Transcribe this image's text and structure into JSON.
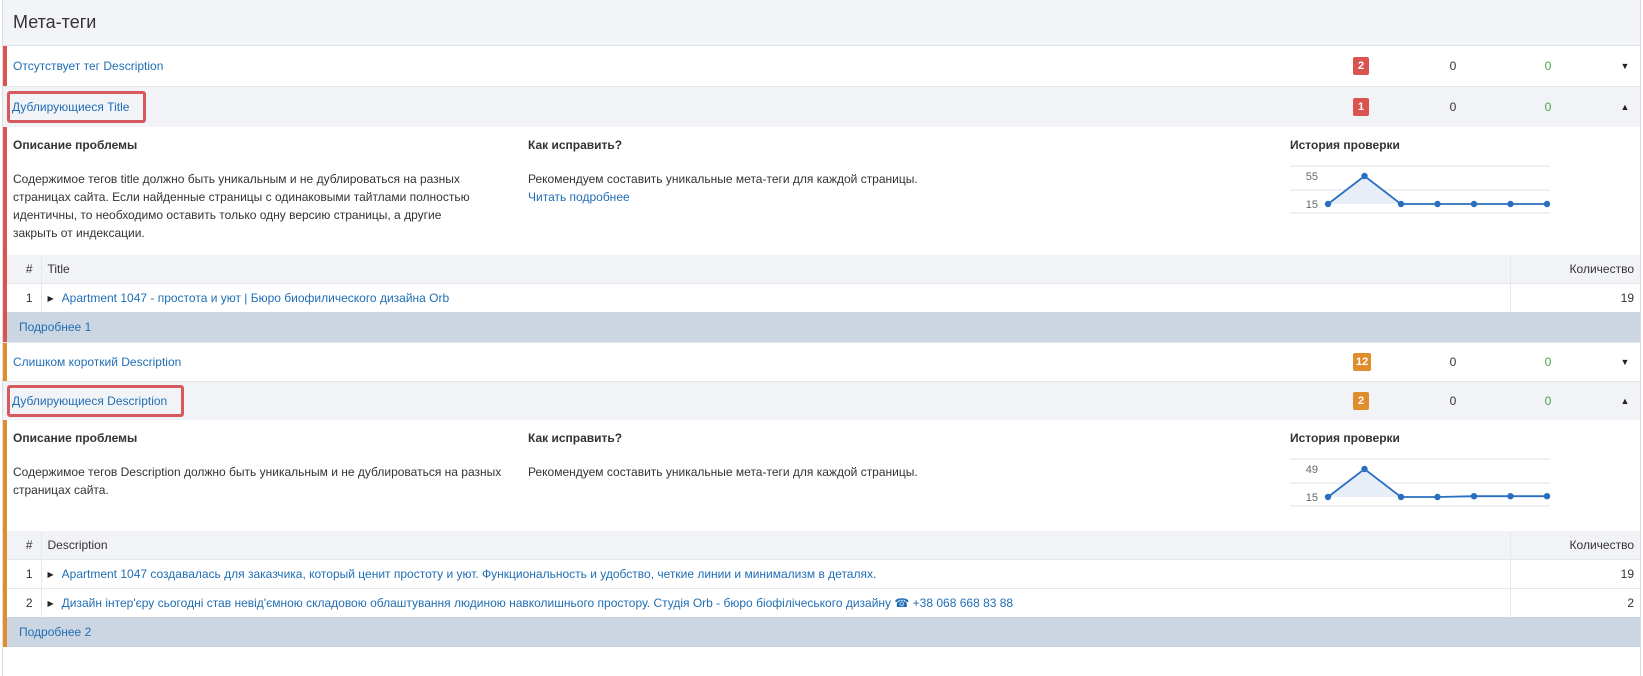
{
  "header": {
    "title": "Мета-теги"
  },
  "sections": [
    {
      "title": "Отсутствует тег Description",
      "count": "2",
      "val0": "0",
      "valg": "0",
      "arrow": "▼"
    },
    {
      "title": "Дублирующиеся Title",
      "count": "1",
      "val0": "0",
      "valg": "0",
      "arrow": "▲",
      "problem_h": "Описание проблемы",
      "problem_t": "Содержимое тегов title должно быть уникальным и не дублироваться на разных страницах сайта. Если найденные страницы с одинаковыми тайтлами полностью идентичны, то необходимо оставить только одну версию страницы, а другие закрыть от индексации.",
      "fix_h": "Как исправить?",
      "fix_t": "Рекомендуем составить уникальные мета-теги для каждой страницы.",
      "fix_link": "Читать подробнее",
      "hist_h": "История проверки",
      "hist": {
        "ticks": [
          "55",
          "15"
        ],
        "values": [
          15,
          55,
          15,
          15,
          15,
          15,
          15
        ]
      },
      "table": {
        "col_num": "#",
        "col_main": "Title",
        "col_qty": "Количество",
        "rows": [
          {
            "num": "1",
            "text": "Apartment 1047 - простота и уют | Бюро биофилического дизайна Orb",
            "qty": "19"
          }
        ]
      },
      "more": "Подробнее 1"
    },
    {
      "title": "Слишком короткий Description",
      "count": "12",
      "val0": "0",
      "valg": "0",
      "arrow": "▼"
    },
    {
      "title": "Дублирующиеся Description",
      "count": "2",
      "val0": "0",
      "valg": "0",
      "arrow": "▲",
      "problem_h": "Описание проблемы",
      "problem_t": "Содержимое тегов Description должно быть уникальным и не дублироваться на разных страницах сайта.",
      "fix_h": "Как исправить?",
      "fix_t": "Рекомендуем составить уникальные мета-теги для каждой страницы.",
      "hist_h": "История проверки",
      "hist": {
        "ticks": [
          "49",
          "15"
        ],
        "values": [
          15,
          49,
          15,
          15,
          16,
          16,
          16
        ]
      },
      "table": {
        "col_num": "#",
        "col_main": "Description",
        "col_qty": "Количество",
        "rows": [
          {
            "num": "1",
            "text": "Apartment 1047 создавалась для заказчика, который ценит простоту и уют. Функциональность и удобство, четкие линии и минимализм в деталях.",
            "qty": "19"
          },
          {
            "num": "2",
            "text": "Дизайн інтер'єру сьогодні став невід'ємною складовою облаштування людиною навколишнього простору. Студія Orb - бюро біофілічеського дизайну ☎ +38 068 668 83 88",
            "qty": "2"
          }
        ]
      },
      "more": "Подробнее 2"
    }
  ],
  "colors": {
    "red": "#d9534f",
    "orange": "#e08e2d",
    "link": "#1f6eb5",
    "green": "#47a447",
    "chart": "#2a6fbf"
  }
}
